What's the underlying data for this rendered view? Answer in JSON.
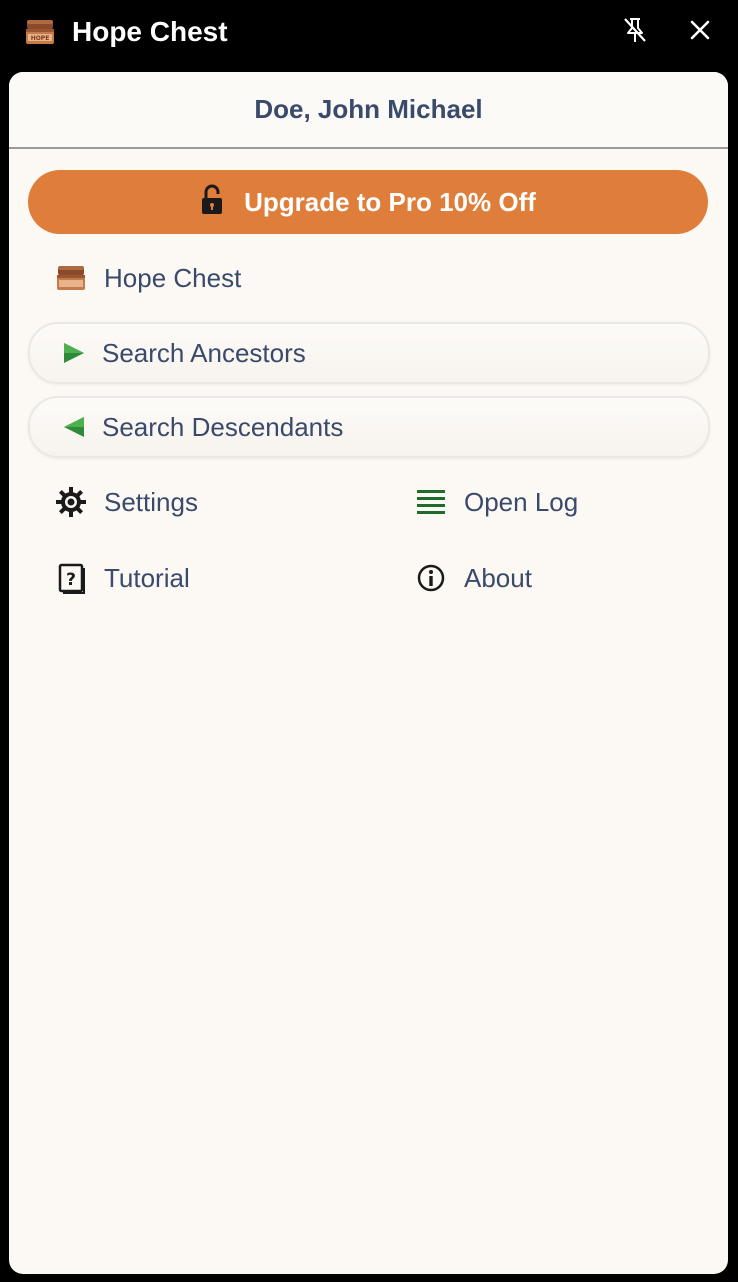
{
  "titlebar": {
    "app_title": "Hope Chest",
    "icons": {
      "app": "hope-chest-icon",
      "pin": "unpin-icon",
      "close": "close-icon"
    }
  },
  "header": {
    "user_name": "Doe, John Michael"
  },
  "upgrade": {
    "label": "Upgrade to Pro 10% Off",
    "icon": "unlocked-lock-icon",
    "color": "#de7e3a"
  },
  "menu": {
    "hope_chest": {
      "label": "Hope Chest",
      "icon": "hope-chest-icon"
    },
    "search_ancestors": {
      "label": "Search Ancestors",
      "icon": "play-right-icon"
    },
    "search_descendants": {
      "label": "Search Descendants",
      "icon": "play-left-icon"
    },
    "settings": {
      "label": "Settings",
      "icon": "gear-icon"
    },
    "open_log": {
      "label": "Open Log",
      "icon": "list-lines-icon"
    },
    "tutorial": {
      "label": "Tutorial",
      "icon": "help-book-icon"
    },
    "about": {
      "label": "About",
      "icon": "info-icon"
    }
  },
  "colors": {
    "text": "#3a4a6b",
    "accent_green": "#2f8a3a",
    "panel_bg": "#fcf8f4"
  }
}
